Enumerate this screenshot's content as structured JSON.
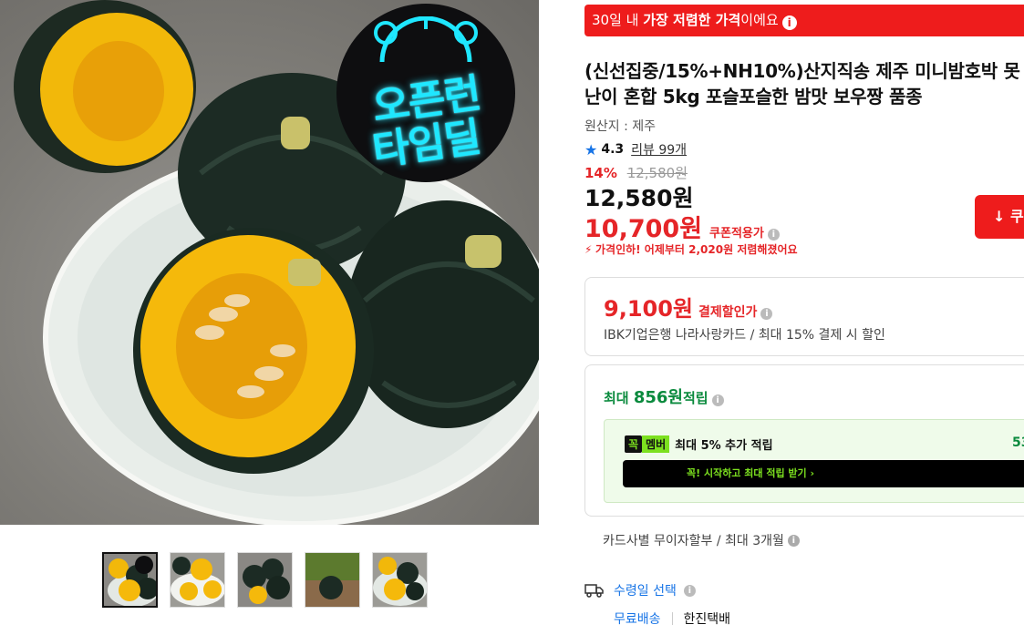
{
  "main_image": {
    "badge_line1": "오픈런",
    "badge_line2": "타임딜"
  },
  "thumbnails": [
    {
      "name": "thumb-1",
      "active": true
    },
    {
      "name": "thumb-2",
      "active": false
    },
    {
      "name": "thumb-3",
      "active": false
    },
    {
      "name": "thumb-4",
      "active": false
    },
    {
      "name": "thumb-5",
      "active": false
    }
  ],
  "lowest_bar": {
    "prefix": "30일 내 ",
    "bold": "가장 저렴한 가격",
    "suffix": "이에요",
    "info": "i"
  },
  "product": {
    "title": "(신선집중/15%+NH10%)산지직송 제주 미니밤호박 못난이 혼합 5kg 포슬포슬한 밤맛 보우짱 품종",
    "origin": "원산지 : 제주",
    "rating": "4.3",
    "review_label": "리뷰 99개",
    "discount_pct": "14%",
    "original_price": "12,580원",
    "price": "12,580원",
    "coupon_price": "10,700원",
    "coupon_label": "쿠폰적용가",
    "price_drop": "가격인하! 어제부터 2,020원 저렴해졌어요",
    "coupon_button": "쿠"
  },
  "card_discount": {
    "amount": "9,100원",
    "label": "결제할인가",
    "desc": "IBK기업은행 나라사랑카드 / 최대 15% 결제 시 할인"
  },
  "points": {
    "prefix": "최대 ",
    "amount": "856원",
    "suffix": " 적립",
    "member_k": "꼭",
    "member_m": "멤버",
    "member_text": "최대 5% 추가 적립",
    "member_amount": "53",
    "member_button": "꼭! 시작하고 최대 적립 받기 ›"
  },
  "installment": "카드사별 무이자할부 / 최대 3개월",
  "delivery": {
    "title": "수령일 선택",
    "free": "무료배송",
    "courier": "한진택배"
  },
  "colors": {
    "accent_red": "#ee1c1c",
    "price_red": "#e52528",
    "link_blue": "#1774e6",
    "points_green": "#0a8a3d",
    "member_lime": "#7ce01f"
  }
}
